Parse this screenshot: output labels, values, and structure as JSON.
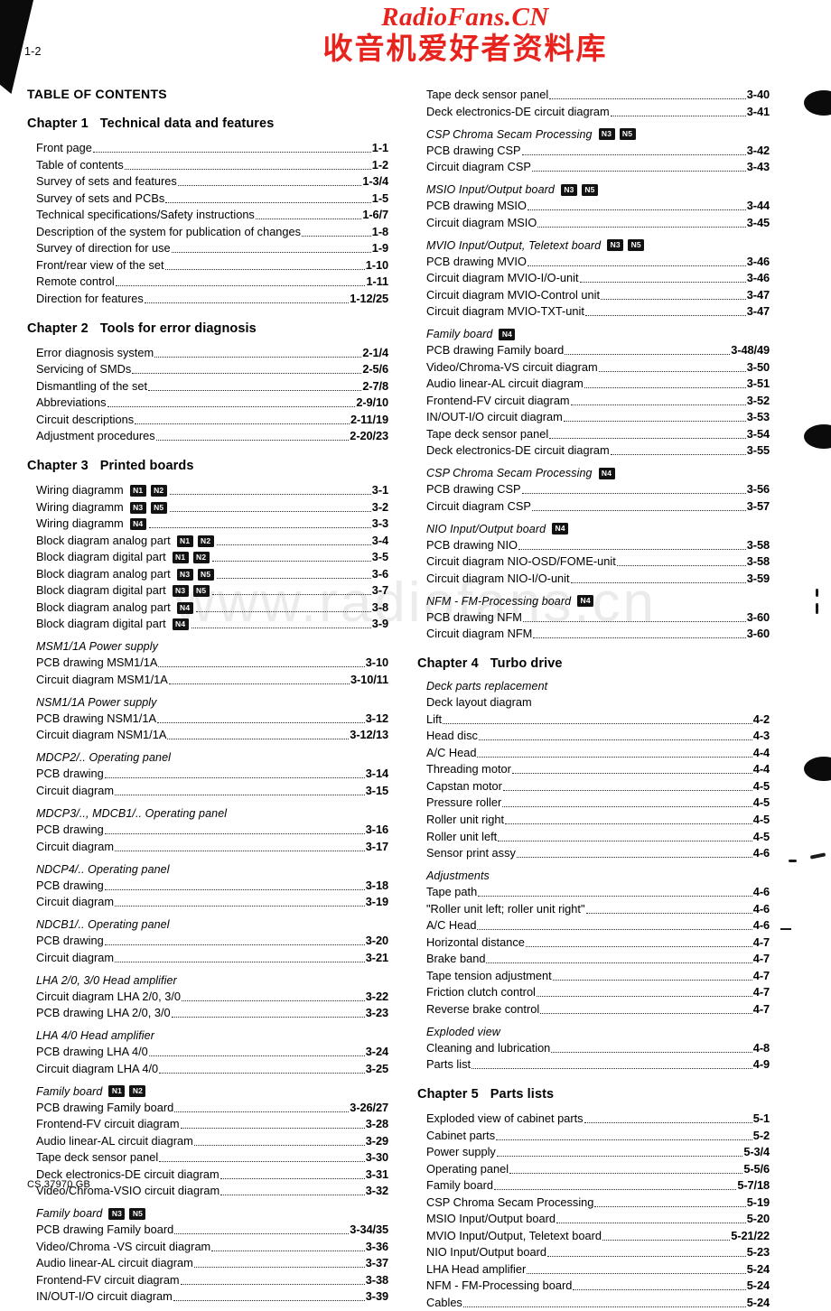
{
  "page": {
    "number": "1-2",
    "footer_code": "CS 37970 GB",
    "toc_title": "TABLE OF CONTENTS"
  },
  "brand": {
    "english": "RadioFans.CN",
    "chinese": "收音机爱好者资料库",
    "watermark": "www.radiofans.cn",
    "color": "#e8221c",
    "watermark_color": "#ebebeb"
  },
  "left_column": [
    {
      "kind": "chapter",
      "num": "Chapter 1",
      "title": "Technical data and features",
      "entries": [
        {
          "label": "Front page",
          "page": "1-1"
        },
        {
          "label": "Table of contents",
          "page": "1-2"
        },
        {
          "label": "Survey of sets and features",
          "page": "1-3/4"
        },
        {
          "label": "Survey of sets and PCBs",
          "page": "1-5"
        },
        {
          "label": "Technical specifications/Safety instructions",
          "page": "1-6/7"
        },
        {
          "label": "Description of the system for publication of changes",
          "page": "1-8"
        },
        {
          "label": "Survey of direction for use",
          "page": "1-9"
        },
        {
          "label": "Front/rear view of the set",
          "page": "1-10"
        },
        {
          "label": "Remote control",
          "page": "1-11"
        },
        {
          "label": "Direction for features",
          "page": "1-12/25"
        }
      ]
    },
    {
      "kind": "chapter",
      "num": "Chapter 2",
      "title": "Tools for error diagnosis",
      "entries": [
        {
          "label": "Error diagnosis system",
          "page": "2-1/4"
        },
        {
          "label": "Servicing of SMDs",
          "page": "2-5/6"
        },
        {
          "label": "Dismantling of the set",
          "page": "2-7/8"
        },
        {
          "label": "Abbreviations",
          "page": "2-9/10"
        },
        {
          "label": "Circuit descriptions",
          "page": "2-11/19"
        },
        {
          "label": "Adjustment procedures",
          "page": "2-20/23"
        }
      ]
    },
    {
      "kind": "chapter",
      "num": "Chapter 3",
      "title": "Printed boards",
      "entries": [
        {
          "label": "Wiring diagramm",
          "badges": [
            "N1",
            "N2"
          ],
          "page": "3-1"
        },
        {
          "label": "Wiring diagramm",
          "badges": [
            "N3",
            "N5"
          ],
          "page": "3-2"
        },
        {
          "label": "Wiring diagramm",
          "badges": [
            "N4"
          ],
          "page": "3-3"
        },
        {
          "label": "Block diagram analog part",
          "badges": [
            "N1",
            "N2"
          ],
          "page": "3-4"
        },
        {
          "label": "Block diagram digital part",
          "badges": [
            "N1",
            "N2"
          ],
          "page": "3-5"
        },
        {
          "label": "Block diagram analog part",
          "badges": [
            "N3",
            "N5"
          ],
          "page": "3-6"
        },
        {
          "label": "Block diagram digital part",
          "badges": [
            "N3",
            "N5"
          ],
          "page": "3-7"
        },
        {
          "label": "Block diagram analog part",
          "badges": [
            "N4"
          ],
          "page": "3-8"
        },
        {
          "label": "Block diagram digital part",
          "badges": [
            "N4"
          ],
          "page": "3-9"
        }
      ]
    },
    {
      "kind": "group",
      "title": "MSM1/1A Power supply",
      "entries": [
        {
          "label": "PCB drawing MSM1/1A",
          "page": "3-10"
        },
        {
          "label": "Circuit diagram MSM1/1A",
          "page": "3-10/11"
        }
      ]
    },
    {
      "kind": "group",
      "title": "NSM1/1A Power supply",
      "entries": [
        {
          "label": "PCB drawing NSM1/1A",
          "page": "3-12"
        },
        {
          "label": "Circuit diagram NSM1/1A",
          "page": "3-12/13"
        }
      ]
    },
    {
      "kind": "group",
      "title": "MDCP2/.. Operating panel",
      "entries": [
        {
          "label": "PCB drawing",
          "page": "3-14"
        },
        {
          "label": "Circuit diagram",
          "page": "3-15"
        }
      ]
    },
    {
      "kind": "group",
      "title": "MDCP3/.., MDCB1/.. Operating panel",
      "entries": [
        {
          "label": "PCB drawing",
          "page": "3-16"
        },
        {
          "label": "Circuit diagram",
          "page": "3-17"
        }
      ]
    },
    {
      "kind": "group",
      "title": "NDCP4/.. Operating panel",
      "entries": [
        {
          "label": "PCB drawing",
          "page": "3-18"
        },
        {
          "label": "Circuit diagram",
          "page": "3-19"
        }
      ]
    },
    {
      "kind": "group",
      "title": "NDCB1/.. Operating panel",
      "entries": [
        {
          "label": "PCB drawing",
          "page": "3-20"
        },
        {
          "label": "Circuit diagram",
          "page": "3-21"
        }
      ]
    },
    {
      "kind": "group",
      "title": "LHA 2/0, 3/0 Head amplifier",
      "entries": [
        {
          "label": "Circuit diagram LHA 2/0, 3/0",
          "page": "3-22"
        },
        {
          "label": "PCB drawing LHA 2/0, 3/0",
          "page": "3-23"
        }
      ]
    },
    {
      "kind": "group",
      "title": "LHA 4/0 Head amplifier",
      "entries": [
        {
          "label": "PCB drawing LHA 4/0",
          "page": "3-24"
        },
        {
          "label": "Circuit diagram LHA 4/0",
          "page": "3-25"
        }
      ]
    },
    {
      "kind": "group",
      "title": "Family board",
      "badges": [
        "N1",
        "N2"
      ],
      "entries": [
        {
          "label": "PCB drawing Family board",
          "page": "3-26/27"
        },
        {
          "label": "Frontend-FV circuit diagram",
          "page": "3-28"
        },
        {
          "label": "Audio linear-AL circuit diagram",
          "page": "3-29"
        },
        {
          "label": "Tape deck sensor panel",
          "page": "3-30"
        },
        {
          "label": "Deck electronics-DE circuit diagram",
          "page": "3-31"
        },
        {
          "label": "Video/Chroma-VSIO circuit diagram",
          "page": "3-32"
        }
      ]
    },
    {
      "kind": "group",
      "title": "Family board",
      "badges": [
        "N3",
        "N5"
      ],
      "entries": [
        {
          "label": "PCB drawing Family board",
          "page": "3-34/35"
        },
        {
          "label": "Video/Chroma -VS circuit diagram",
          "page": "3-36"
        },
        {
          "label": "Audio linear-AL circuit diagram",
          "page": "3-37"
        },
        {
          "label": "Frontend-FV circuit diagram",
          "page": "3-38"
        },
        {
          "label": "IN/OUT-I/O circuit diagram",
          "page": "3-39"
        }
      ]
    }
  ],
  "right_column": [
    {
      "kind": "plain",
      "entries": [
        {
          "label": "Tape deck sensor panel",
          "page": "3-40"
        },
        {
          "label": "Deck electronics-DE circuit diagram",
          "page": "3-41"
        }
      ]
    },
    {
      "kind": "group",
      "title": "CSP Chroma Secam Processing",
      "badges": [
        "N3",
        "N5"
      ],
      "entries": [
        {
          "label": "PCB drawing CSP",
          "page": "3-42"
        },
        {
          "label": "Circuit diagram CSP",
          "page": "3-43"
        }
      ]
    },
    {
      "kind": "group",
      "title": "MSIO Input/Output board",
      "badges": [
        "N3",
        "N5"
      ],
      "entries": [
        {
          "label": "PCB drawing MSIO",
          "page": "3-44"
        },
        {
          "label": "Circuit diagram MSIO",
          "page": "3-45"
        }
      ]
    },
    {
      "kind": "group",
      "title": "MVIO Input/Output, Teletext board",
      "badges": [
        "N3",
        "N5"
      ],
      "entries": [
        {
          "label": "PCB drawing MVIO",
          "page": "3-46"
        },
        {
          "label": "Circuit diagram MVIO-I/O-unit",
          "page": "3-46"
        },
        {
          "label": "Circuit diagram MVIO-Control unit",
          "page": "3-47"
        },
        {
          "label": "Circuit diagram MVIO-TXT-unit",
          "page": "3-47"
        }
      ]
    },
    {
      "kind": "group",
      "title": "Family board",
      "badges": [
        "N4"
      ],
      "entries": [
        {
          "label": "PCB drawing Family board",
          "page": "3-48/49"
        },
        {
          "label": "Video/Chroma-VS circuit diagram",
          "page": "3-50"
        },
        {
          "label": "Audio linear-AL circuit diagram",
          "page": "3-51"
        },
        {
          "label": "Frontend-FV circuit diagram",
          "page": "3-52"
        },
        {
          "label": "IN/OUT-I/O circuit diagram",
          "page": "3-53"
        },
        {
          "label": "Tape deck sensor panel",
          "page": "3-54"
        },
        {
          "label": "Deck electronics-DE circuit diagram",
          "page": "3-55"
        }
      ]
    },
    {
      "kind": "group",
      "title": "CSP Chroma Secam Processing",
      "badges": [
        "N4"
      ],
      "entries": [
        {
          "label": "PCB drawing CSP",
          "page": "3-56"
        },
        {
          "label": "Circuit diagram CSP",
          "page": "3-57"
        }
      ]
    },
    {
      "kind": "group",
      "title": "NIO Input/Output board",
      "badges": [
        "N4"
      ],
      "entries": [
        {
          "label": "PCB drawing NIO",
          "page": "3-58"
        },
        {
          "label": "Circuit diagram NIO-OSD/FOME-unit",
          "page": "3-58"
        },
        {
          "label": "Circuit diagram NIO-I/O-unit",
          "page": "3-59"
        }
      ]
    },
    {
      "kind": "group",
      "title": "NFM - FM-Processing board",
      "badges": [
        "N4"
      ],
      "entries": [
        {
          "label": "PCB drawing NFM",
          "page": "3-60"
        },
        {
          "label": "Circuit diagram NFM",
          "page": "3-60"
        }
      ]
    },
    {
      "kind": "chapter",
      "num": "Chapter 4",
      "title": "Turbo drive",
      "entries": []
    },
    {
      "kind": "group",
      "title": "Deck parts replacement",
      "entries": [
        {
          "label": "Deck layout diagram",
          "page": "",
          "no_dots": true
        },
        {
          "label": "Lift",
          "page": "4-2"
        },
        {
          "label": "Head disc",
          "page": "4-3"
        },
        {
          "label": "A/C Head",
          "page": "4-4"
        },
        {
          "label": "Threading motor",
          "page": "4-4"
        },
        {
          "label": "Capstan motor",
          "page": "4-5"
        },
        {
          "label": "Pressure roller",
          "page": "4-5"
        },
        {
          "label": "Roller unit right",
          "page": "4-5"
        },
        {
          "label": "Roller unit left",
          "page": "4-5"
        },
        {
          "label": "Sensor print assy",
          "page": "4-6"
        }
      ]
    },
    {
      "kind": "group",
      "title": "Adjustments",
      "entries": [
        {
          "label": "Tape path",
          "page": "4-6"
        },
        {
          "label": "\"Roller unit left; roller unit right\"",
          "page": "4-6"
        },
        {
          "label": "A/C Head",
          "page": "4-6"
        },
        {
          "label": "Horizontal distance",
          "page": "4-7"
        },
        {
          "label": "Brake band",
          "page": "4-7"
        },
        {
          "label": "Tape tension adjustment",
          "page": "4-7"
        },
        {
          "label": "Friction clutch control",
          "page": "4-7"
        },
        {
          "label": "Reverse brake control",
          "page": "4-7"
        }
      ]
    },
    {
      "kind": "group",
      "title": "Exploded view",
      "entries": [
        {
          "label": "Cleaning and lubrication",
          "page": "4-8"
        },
        {
          "label": "Parts list",
          "page": "4-9"
        }
      ]
    },
    {
      "kind": "chapter",
      "num": "Chapter 5",
      "title": "Parts lists",
      "entries": [
        {
          "label": "Exploded view of cabinet parts",
          "page": "5-1"
        },
        {
          "label": "Cabinet parts",
          "page": "5-2"
        },
        {
          "label": "Power supply",
          "page": "5-3/4"
        },
        {
          "label": "Operating panel",
          "page": "5-5/6"
        },
        {
          "label": "Family board",
          "page": "5-7/18"
        },
        {
          "label": "CSP Chroma Secam Processing",
          "page": "5-19"
        },
        {
          "label": "MSIO Input/Output board",
          "page": "5-20"
        },
        {
          "label": "MVIO Input/Output, Teletext board",
          "page": "5-21/22"
        },
        {
          "label": "NIO Input/Output board",
          "page": "5-23"
        },
        {
          "label": "LHA Head amplifier",
          "page": "5-24"
        },
        {
          "label": "NFM - FM-Processing board",
          "page": "5-24"
        },
        {
          "label": "Cables",
          "page": "5-24"
        }
      ]
    }
  ]
}
